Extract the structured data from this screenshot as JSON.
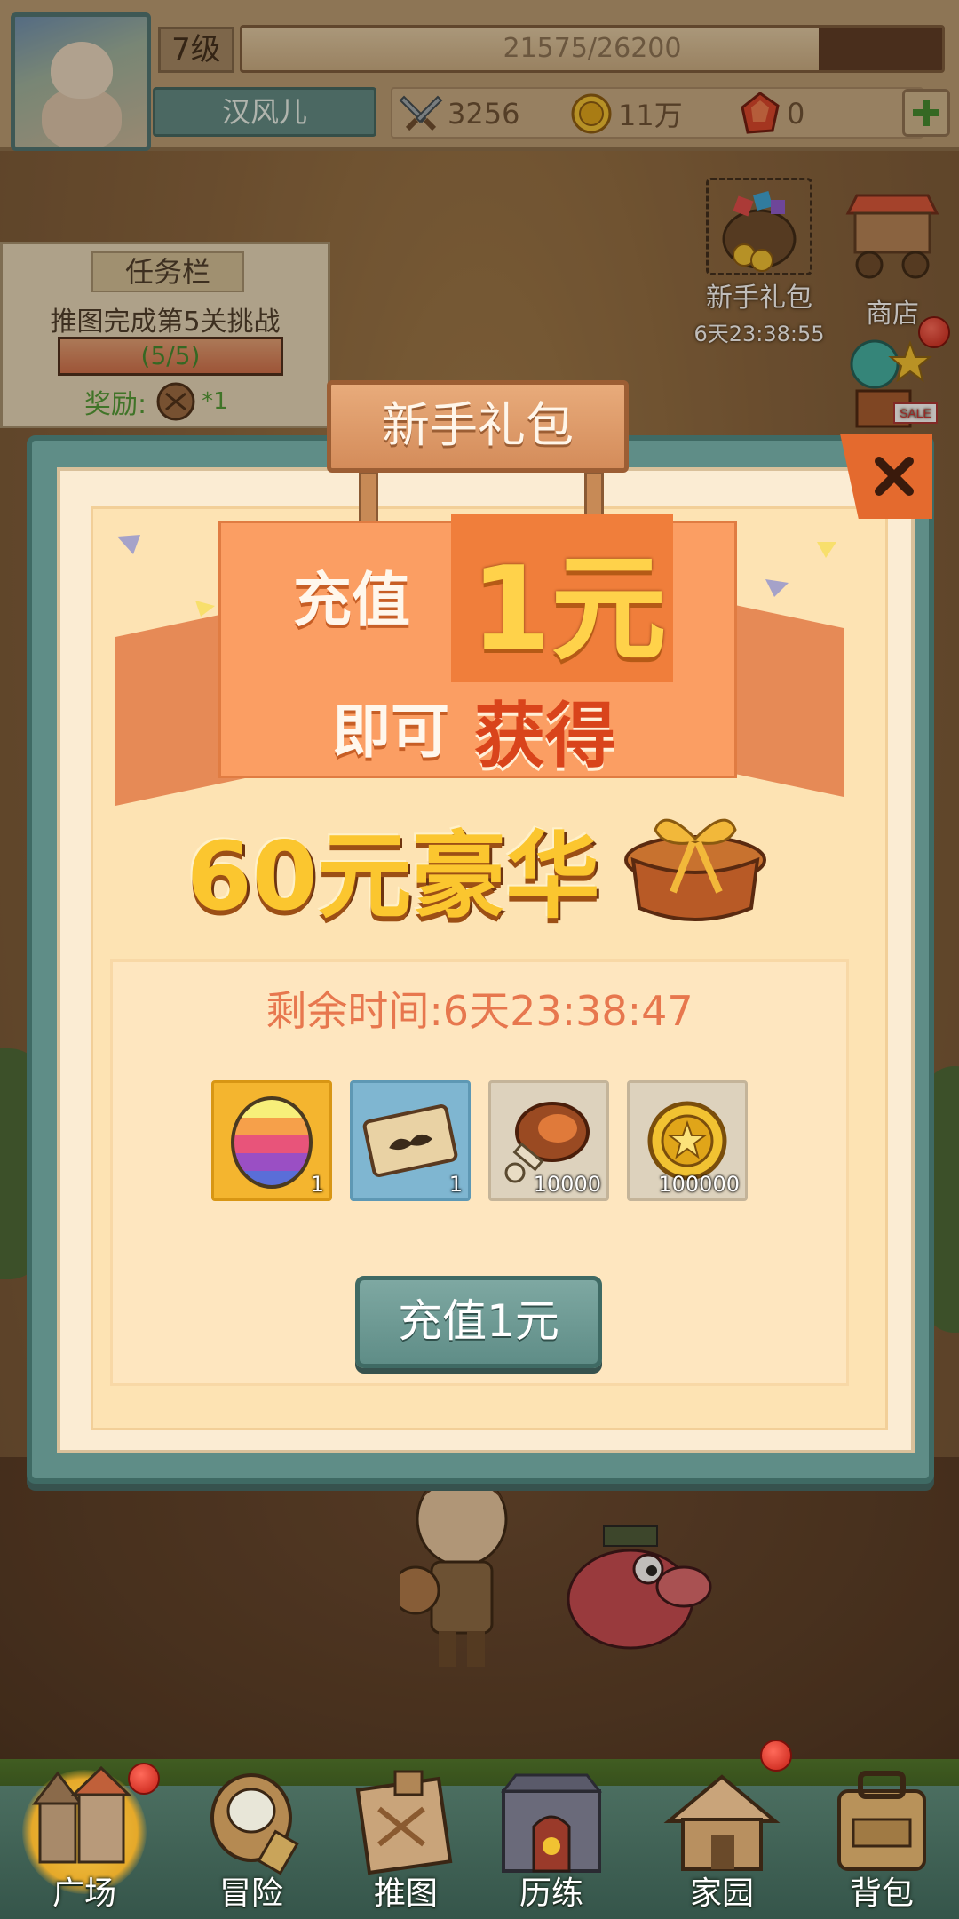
{
  "hud": {
    "level": "7级",
    "exp_text": "21575/26200",
    "exp_current": 21575,
    "exp_max": 26200,
    "player_name": "汉风儿",
    "combat_power": "3256",
    "gold": "11万",
    "gems": "0",
    "add_icon": "plus-icon"
  },
  "side_buttons": {
    "newbie_pack": {
      "label": "新手礼包",
      "timer": "6天23:38:55"
    },
    "shop": {
      "label": "商店"
    },
    "sale_badge": "SALE"
  },
  "task": {
    "title": "任务栏",
    "description": "推图完成第5关挑战",
    "progress_text": "(5/5)",
    "progress_fraction": 1.0,
    "reward_label": "奖励:",
    "reward_count": "*1"
  },
  "popup": {
    "title": "新手礼包",
    "banner_line1_a": "充值",
    "banner_line1_b": "1元",
    "banner_line2_a": "即可",
    "banner_line2_b": "获得",
    "offer_text": "60元豪华",
    "countdown": "剩余时间:6天23:38:47",
    "items": [
      {
        "icon": "rainbow-egg-icon",
        "qty": "1",
        "style": "gold"
      },
      {
        "icon": "mustache-card-icon",
        "qty": "1",
        "style": "blue"
      },
      {
        "icon": "meat-icon",
        "qty": "10000",
        "style": "plain"
      },
      {
        "icon": "gold-coin-icon",
        "qty": "100000",
        "style": "plain"
      }
    ],
    "button_label": "充值1元",
    "close_icon": "close-icon"
  },
  "bottom_nav": [
    {
      "label": "广场",
      "icon": "plaza-icon",
      "active": true,
      "badge": true
    },
    {
      "label": "冒险",
      "icon": "adventure-icon",
      "active": false,
      "badge": false
    },
    {
      "label": "推图",
      "icon": "map-icon",
      "active": false,
      "badge": false
    },
    {
      "label": "历练",
      "icon": "training-icon",
      "active": false,
      "badge": false
    },
    {
      "label": "家园",
      "icon": "home-icon",
      "active": false,
      "badge": true
    },
    {
      "label": "背包",
      "icon": "bag-icon",
      "active": false,
      "badge": false
    }
  ],
  "colors": {
    "accent_orange": "#fb9e63",
    "teal_frame": "#5f8d87",
    "countdown_text": "#e7774e",
    "offer_yellow": "#fbc62f"
  }
}
